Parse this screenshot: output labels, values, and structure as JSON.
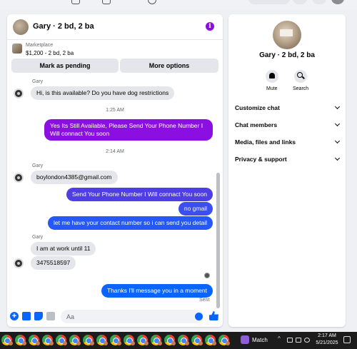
{
  "chat": {
    "title": "Gary · 2 bd, 2 ba",
    "listing": {
      "source": "Marketplace",
      "price_line": "$1,200 - 2 bd, 2 ba"
    },
    "buttons": {
      "mark_pending": "Mark as pending",
      "more_options": "More options"
    },
    "messages": [
      {
        "sender": "Gary",
        "direction": "in",
        "text": "Hi, is this available? Do you have dog restrictions"
      },
      {
        "timestamp": "1:25 AM"
      },
      {
        "direction": "out",
        "text": "Yes Its Still Available, Please Send Your Phone Number I Will connact You soon"
      },
      {
        "timestamp": "2:14 AM"
      },
      {
        "sender": "Gary",
        "direction": "in",
        "text": "boylondon4385@gmail.com"
      },
      {
        "direction": "out",
        "text": "Send Your Phone Number I Will connact You soon"
      },
      {
        "direction": "out",
        "text": "no gmail"
      },
      {
        "direction": "out",
        "text": "let me have your contact number so i can send you detail"
      },
      {
        "sender": "Gary",
        "direction": "in",
        "text": "I am at work until 11"
      },
      {
        "direction": "in",
        "text": "3475518597"
      },
      {
        "direction": "out",
        "text": "Thanks I'll message you in a moment"
      }
    ],
    "sent_status": "Sent",
    "composer_placeholder": "Aa",
    "colors": {
      "out_gradient_top": "#8a0fe0",
      "out_gradient_bottom": "#0866ff",
      "in_bubble": "#e4e6eb"
    }
  },
  "details": {
    "title": "Gary · 2 bd, 2 ba",
    "mute_label": "Mute",
    "search_label": "Search",
    "sections": [
      {
        "label": "Customize chat"
      },
      {
        "label": "Chat members"
      },
      {
        "label": "Media, files and links"
      },
      {
        "label": "Privacy & support"
      }
    ]
  },
  "taskbar": {
    "weather": "Match",
    "time": "2:17 AM",
    "date": "5/21/2025"
  }
}
